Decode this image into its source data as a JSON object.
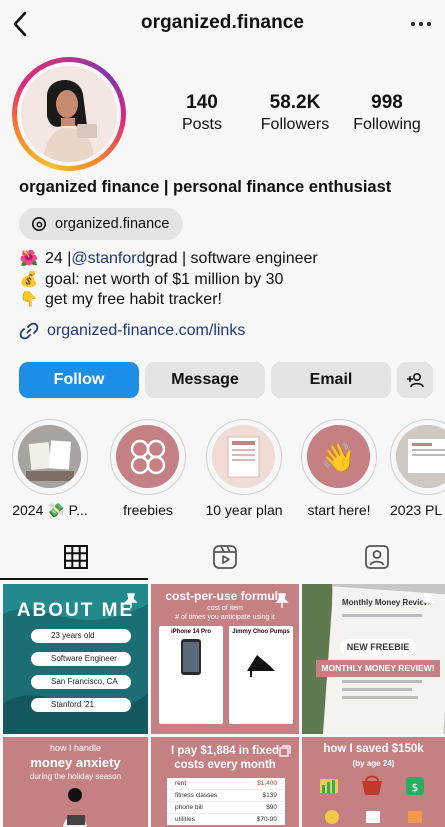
{
  "header": {
    "username": "organized.finance"
  },
  "stats": [
    {
      "value": "140",
      "label": "Posts"
    },
    {
      "value": "58.2K",
      "label": "Followers"
    },
    {
      "value": "998",
      "label": "Following"
    }
  ],
  "profile": {
    "display_name": "organized finance | personal finance enthusiast",
    "threads_handle": "organized.finance",
    "bio_line1_pre": "24 | ",
    "bio_mention": "@stanford",
    "bio_line1_post": " grad | software engineer",
    "bio_line2": "goal: net worth of $1 million by 30",
    "bio_line3": "get my free habit tracker!",
    "link": "organized-finance.com/links"
  },
  "actions": {
    "follow": "Follow",
    "message": "Message",
    "email": "Email"
  },
  "highlights": [
    {
      "label": "2024 💸 P..."
    },
    {
      "label": "freebies"
    },
    {
      "label": "10 year plan"
    },
    {
      "label": "start here!"
    },
    {
      "label": "2023 PL"
    }
  ],
  "posts": {
    "p1_title": "ABOUT ME",
    "p1_items": [
      "23 years old",
      "Software Engineer",
      "San Francisco, CA",
      "Stanford '21"
    ],
    "p2_title": "cost-per-use formula",
    "p2_sub1": "cost of item",
    "p2_sub2": "# of times you anticipate using it",
    "p2_left": "iPhone 14 Pro",
    "p2_right": "Jimmy Choo Pumps",
    "p3_badge1": "NEW FREEBIE",
    "p3_badge2": "MONTHLY MONEY REVIEW!",
    "p3_doc_title": "Monthly Money Review",
    "p4_line1": "how I handle",
    "p4_line2": "money anxiety",
    "p4_line3": "during the holiday season",
    "p5_line1": "I pay $1,884 in fixed",
    "p5_line2": "costs every month",
    "p5_rows": [
      {
        "item": "rent",
        "cost": "$1,400"
      },
      {
        "item": "fitness classes",
        "cost": "$139"
      },
      {
        "item": "phone bill",
        "cost": "$90"
      },
      {
        "item": "utilities",
        "cost": "$70-90"
      }
    ],
    "p6_line1": "how I saved $150k",
    "p6_line2": "(by age 24)"
  },
  "colors": {
    "follow_blue": "#1d8ee6",
    "pill_gray": "#e4e4e4",
    "mauve": "#c58084",
    "teal": "#1f8a8a",
    "link_blue": "#1e3a78"
  }
}
